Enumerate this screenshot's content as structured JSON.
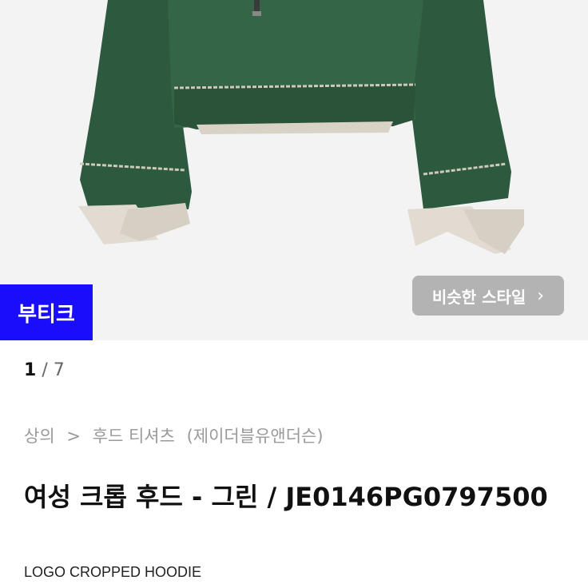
{
  "product_image": {
    "badge_label": "부티크",
    "similar_button_label": "비슷한 스타일",
    "similar_button_icon": "chevron-right-icon",
    "colors": {
      "hoodie": "#2e5a40",
      "cuff": "#ddd6cc",
      "background": "#f3f3f4",
      "badge": "#1a0dfc"
    }
  },
  "pager": {
    "current": "1",
    "total": "7"
  },
  "breadcrumb": {
    "category": "상의",
    "separator": ">",
    "subcategory": "후드 티셔츠",
    "brand": "(제이더블유앤더슨)"
  },
  "product": {
    "title": "여성 크롭 후드 - 그린 / JE0146PG0797500",
    "subtitle": "LOGO CROPPED HOODIE"
  }
}
